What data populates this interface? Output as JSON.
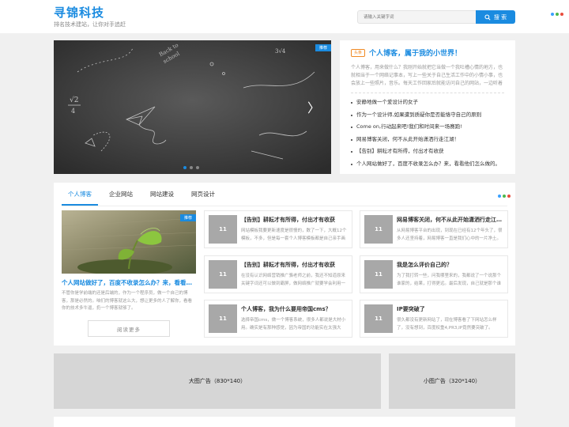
{
  "header": {
    "logo": "寻锦科技",
    "slogan": "排名技术建站，让你对手追赶",
    "search_placeholder": "请输入关键字词",
    "search_button": "搜 索",
    "dot_colors": [
      "#3aa0ff",
      "#4cb84c",
      "#e84c3d"
    ]
  },
  "slider": {
    "tag": "推荐",
    "prev_icon": "chevron-left-icon",
    "next_icon": "chevron-right-icon",
    "next_glyph": "〉",
    "dot_count": 3,
    "active_dot": 0
  },
  "headline": {
    "badge": "头条",
    "title": "个人博客，属于我的小世界！",
    "desc": "个人博客，用来做什么？我刚开始就把它当做一个我吐槽心情的地方，也就相当于一个网络记事本，写上一些关于自己生活工作中的小情小事，也会放上一些照片，音乐。每天工作回家后就能访问自己的网站，一边听着音乐，一边写写文章。",
    "items": [
      "安静地做一个爱设计的女子",
      "作为一个设计师,如果遭到质疑你是否能恪守自己的原则",
      "Come on,行动起来吧!我们和时间来一场赛跑!",
      "网易博客关闭，何不从此开始潇洒行走江湖！",
      "【告别】耕耘才有所得，付出才有收获",
      "个人网站做好了，百度不收录怎么办？来，看看他们怎么做的。"
    ]
  },
  "tabs": {
    "items": [
      "个人博客",
      "企业网站",
      "网站建设",
      "网页设计"
    ],
    "active": 0,
    "dot_colors": [
      "#3aa0ff",
      "#4cb84c",
      "#e84c3d"
    ]
  },
  "feature": {
    "tag": "推荐",
    "title": "个人网站做好了，百度不收录怎么办？来，看看他们怎么做的。",
    "desc": "不管你是学前端的还是后端的，作为一个程序员，做一个自己的博客，那是必然的。咱们的博客就这么大，想让更多的人了解你，看看你的技术多牛逼，扔一个博客就够了。",
    "more_button": "阅读更多"
  },
  "cards": [
    {
      "thumb": "11",
      "title": "【告别】耕耘才有所得，付出才有收获",
      "desc": "网站模板我要更新速度是很慢的，数了一下，大概12个模板，不多，但是每一套个人博客模板都是自己亲手画的。"
    },
    {
      "thumb": "11",
      "title": "网易博客关闭，何不从此开始潇洒行走江湖！",
      "desc": "从网易博客平台的出现，到现在已经有12个年头了，很多人还坚持着，网易博客一直是我们心中的一片净土。"
    },
    {
      "thumb": "11",
      "title": "【告别】耕耘才有所得，付出才有收获",
      "desc": "在没有认识网络营销推广骆老师之前，我还不知道原来关键字词还可以做到霸屏，做网络推广就要学会利用一切可以利用的资源。"
    },
    {
      "thumb": "11",
      "title": "我是怎么评价自己的？",
      "desc": "为了我打转一些，问我哪里来的，我都说了一个说那个谁家的，结果，打得更远。最后发现，自己就是那个谁家的。"
    },
    {
      "thumb": "11",
      "title": "个人博客，我为什么要用帝国cms？",
      "desc": "选择帝国cms，做一个博客系统，很多人都说是大材小用。确实是有那种感觉，因为帝国的功能实在太强大了。"
    },
    {
      "thumb": "11",
      "title": "IP要突破了",
      "desc": "很久都没有更新网站了，现在博客看了下网站怎么样了，没有想到，百度权重4,PR3,IP竟然要突破了。"
    }
  ],
  "ads": {
    "large": "大图广告（830*140）",
    "small": "小图广告（320*140）"
  }
}
